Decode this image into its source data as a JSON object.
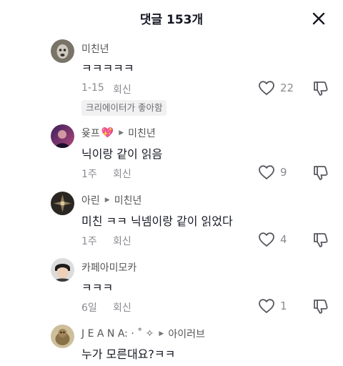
{
  "header": {
    "title": "댓글 153개"
  },
  "comments": [
    {
      "user": "미친년",
      "text": "ㅋㅋㅋㅋㅋ",
      "time": "1-15",
      "reply": "회신",
      "likes": "22",
      "badge": "크리에이터가 좋아함"
    },
    {
      "user": "윶프",
      "emoji": "💖",
      "reply_to": "미친년",
      "text": "닉이랑 같이 읽음",
      "time": "1주",
      "reply": "회신",
      "likes": "9"
    },
    {
      "user": "아린",
      "reply_to": "미친년",
      "text": "미친 ㅋㅋ 닉넴이랑 같이 읽었다",
      "time": "1주",
      "reply": "회신",
      "likes": "4"
    },
    {
      "user": "카페아미모카",
      "text": "ㅋㅋㅋ",
      "time": "6일",
      "reply": "회신",
      "likes": "1"
    },
    {
      "user": "J E A N A: · ˚ ✧",
      "reply_to": "아이러브",
      "text": "누가 모른대요?ㅋㅋ"
    }
  ],
  "icons": [
    "close-icon",
    "heart-icon",
    "thumb-down-icon",
    "reply-arrow-icon"
  ]
}
